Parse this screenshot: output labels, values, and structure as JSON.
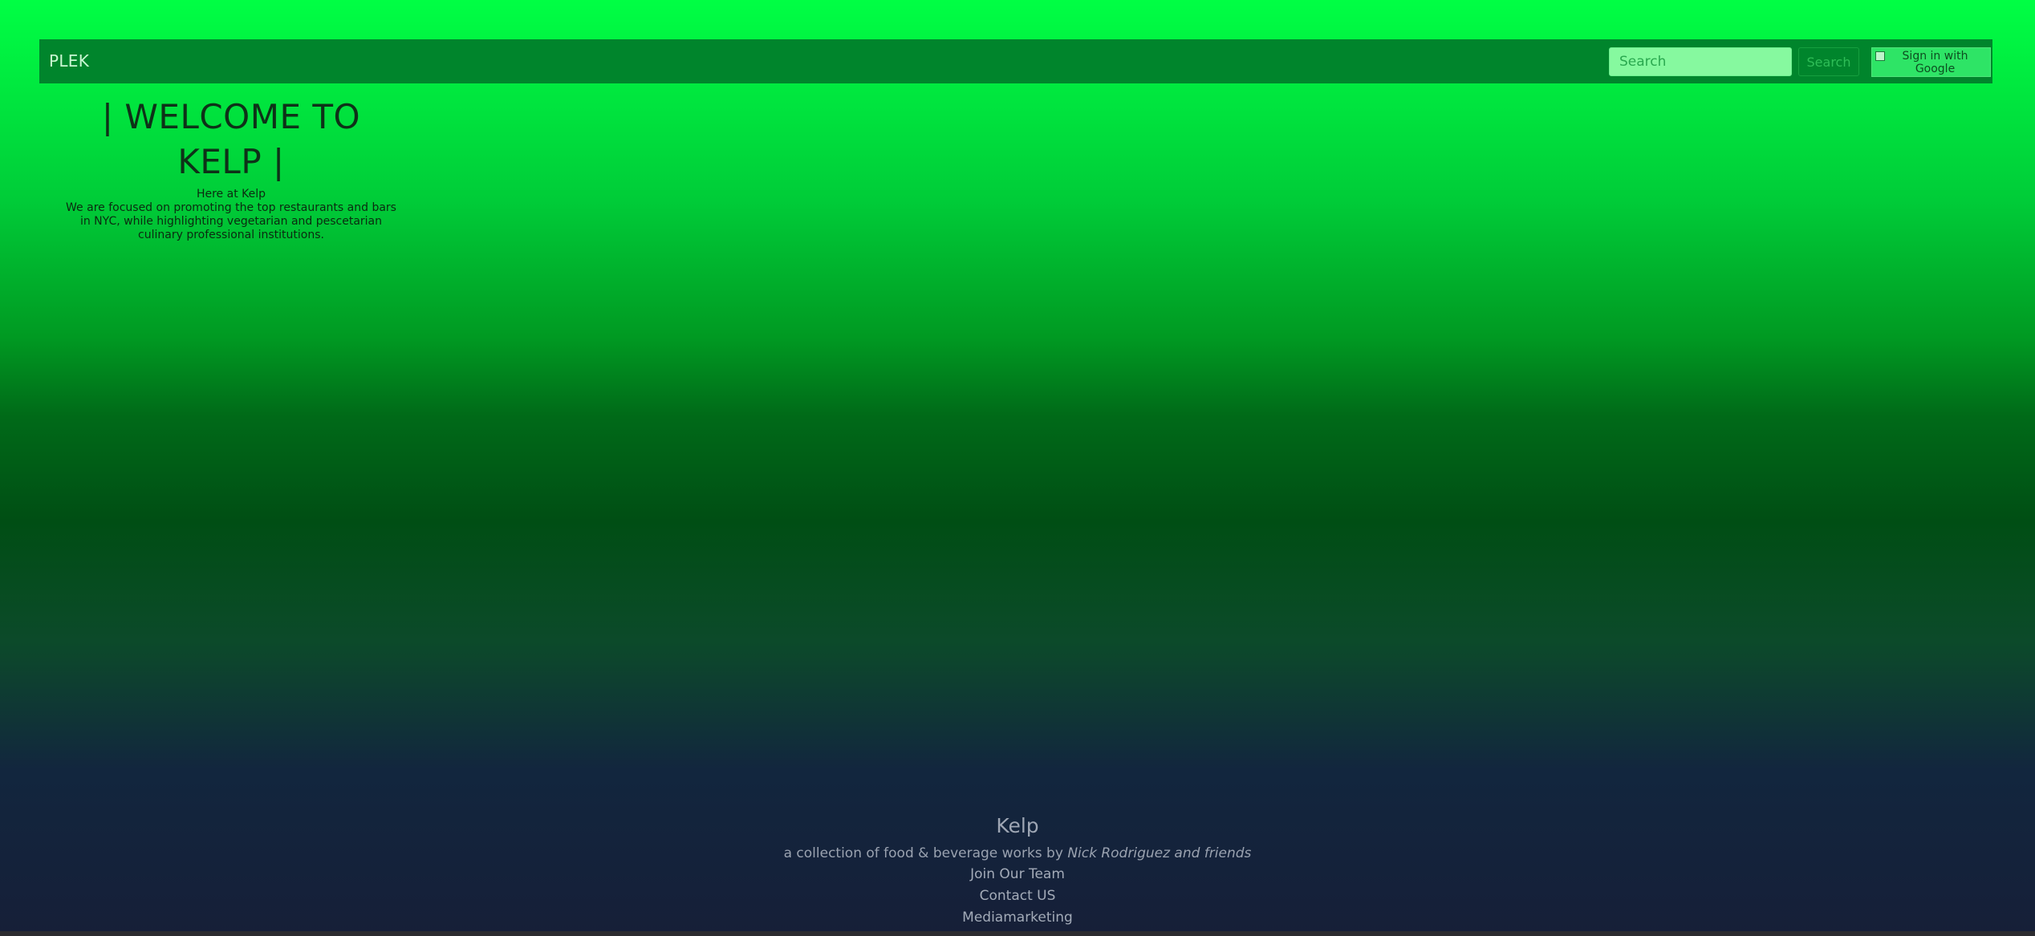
{
  "navbar": {
    "brand": "PLEK",
    "search_placeholder": "Search",
    "search_button": "Search",
    "google_signin_alt": "Sign in with Google"
  },
  "intro": {
    "heading": "| WELCOME TO KELP |",
    "subheading": "Here at Kelp",
    "description": "We are focused on promoting the top restaurants and bars in NYC, while highlighting vegetarian and pescetarian culinary professional institutions."
  },
  "footer": {
    "title": "Kelp",
    "tagline_prefix": "a collection of food & beverage works by ",
    "tagline_author": "Nick Rodriguez and friends",
    "links": [
      "Join Our Team",
      "Contact US",
      "Mediamarketing"
    ]
  },
  "colors": {
    "navbar_bg": "#00852c",
    "search_input_bg": "#86f99f",
    "page_gradient_top": "#00ff44",
    "page_gradient_bottom": "#161f38"
  }
}
